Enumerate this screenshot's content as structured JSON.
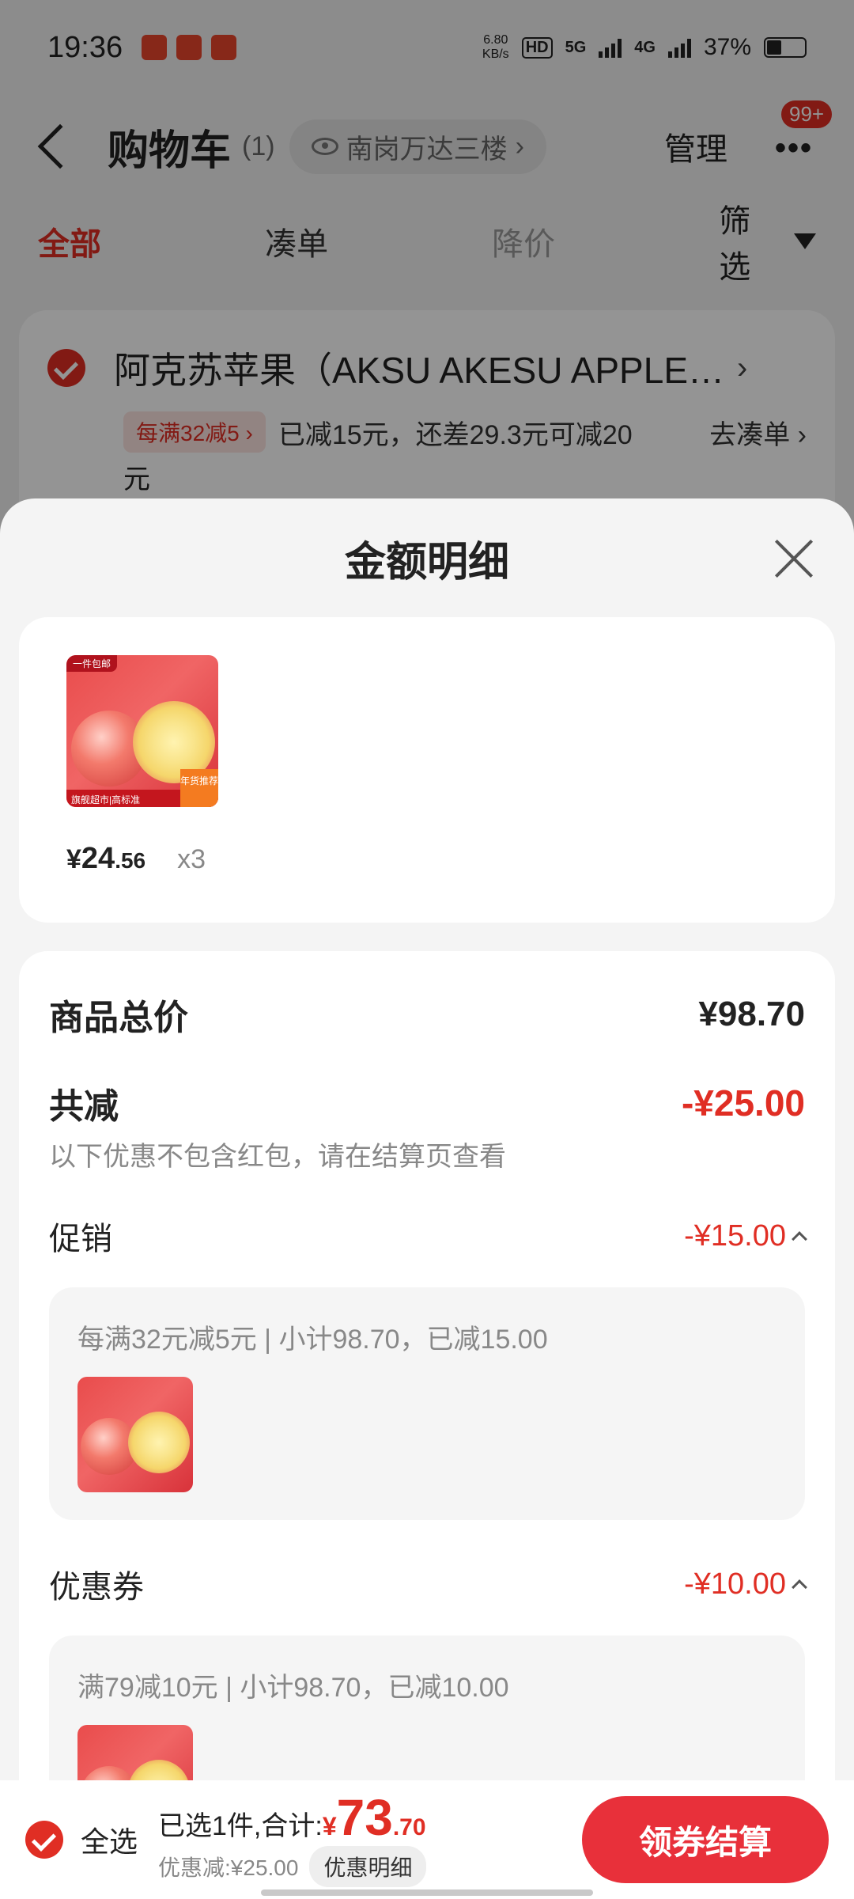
{
  "status_bar": {
    "time": "19:36",
    "net_speed_value": "6.80",
    "net_speed_unit": "KB/s",
    "hd_label": "HD",
    "sim1_label": "5G",
    "sim2_label": "4G",
    "battery": "37%"
  },
  "header": {
    "title": "购物车",
    "count": "(1)",
    "location": "南岗万达三楼",
    "manage": "管理",
    "badge": "99+"
  },
  "tabs": {
    "all": "全部",
    "bundle": "凑单",
    "price_drop": "降价",
    "filter": "筛选"
  },
  "store": {
    "name": "阿克苏苹果（AKSU AKESU APPLE…",
    "promo_tag": "每满32减5",
    "promo_text": "已减15元，还差29.3元可减20",
    "promo_text_wrap": "元",
    "go_bundle": "去凑单"
  },
  "sheet": {
    "title": "金额明细",
    "item": {
      "image_tag": "一件包邮",
      "image_banner": "旗舰超市|高标准",
      "image_badge": "年货推荐",
      "price_symbol": "¥",
      "price_int": "24",
      "price_dec": ".56",
      "qty": "x3"
    },
    "total_label": "商品总价",
    "total_value": "¥98.70",
    "discount_label": "共减",
    "discount_value": "-¥25.00",
    "discount_note": "以下优惠不包含红包，请在结算页查看",
    "promo_label": "促销",
    "promo_value": "-¥15.00",
    "promo_detail": "每满32元减5元 | 小计98.70，已减15.00",
    "coupon_label": "优惠券",
    "coupon_value": "-¥10.00",
    "coupon_detail": "满79减10元 | 小计98.70，已减10.00"
  },
  "bottom_bar": {
    "select_all": "全选",
    "selected_prefix": "已选1件,合计:",
    "total_symbol": "¥",
    "total_int": "73",
    "total_dec": ".70",
    "saved": "优惠减:¥25.00",
    "detail_btn": "优惠明细",
    "checkout": "领券结算"
  },
  "colors": {
    "accent": "#e02e24",
    "checkout_bg": "#e8303a",
    "sheet_bg": "#f4f4f4"
  }
}
